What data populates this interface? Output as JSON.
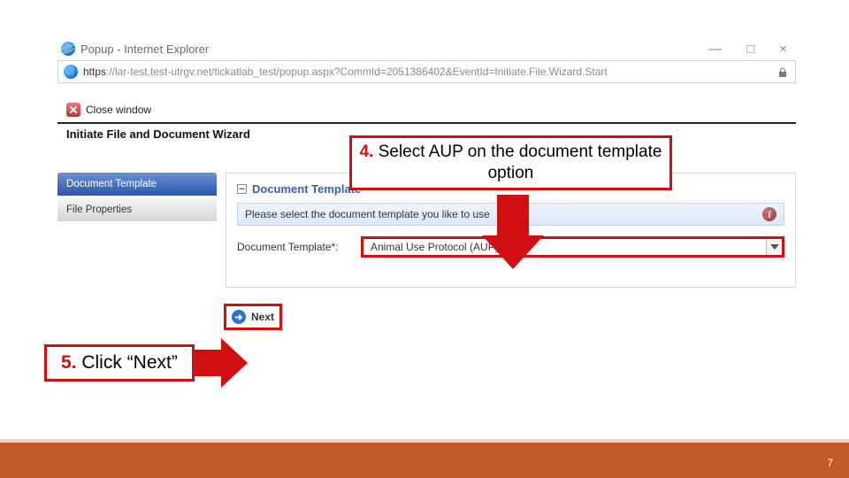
{
  "browser": {
    "title": "Popup - Internet Explorer",
    "url_prefix": "https",
    "url_host": "://lar-test.test-utrgv.net",
    "url_path": "/tickatlab_test/popup.aspx?CommId=2051386402&EventId=Initiate.File.Wizard.Start",
    "win_min": "—",
    "win_max": "□",
    "win_close": "×"
  },
  "page": {
    "close_window": "Close window",
    "section_title": "Initiate File and Document Wizard",
    "nav_active": "Document Template",
    "nav_inactive": "File Properties",
    "panel_title": "Document Template",
    "instruction": "Please select the document template you like to use",
    "field_label": "Document Template*:",
    "select_value": "Animal Use Protocol (AUP)",
    "next_label": "Next"
  },
  "callouts": {
    "step4_num": "4.",
    "step4_text": " Select AUP on the document template option",
    "step5_num": "5.",
    "step5_text": " Click “Next”"
  },
  "footer": {
    "page_num": "7"
  }
}
